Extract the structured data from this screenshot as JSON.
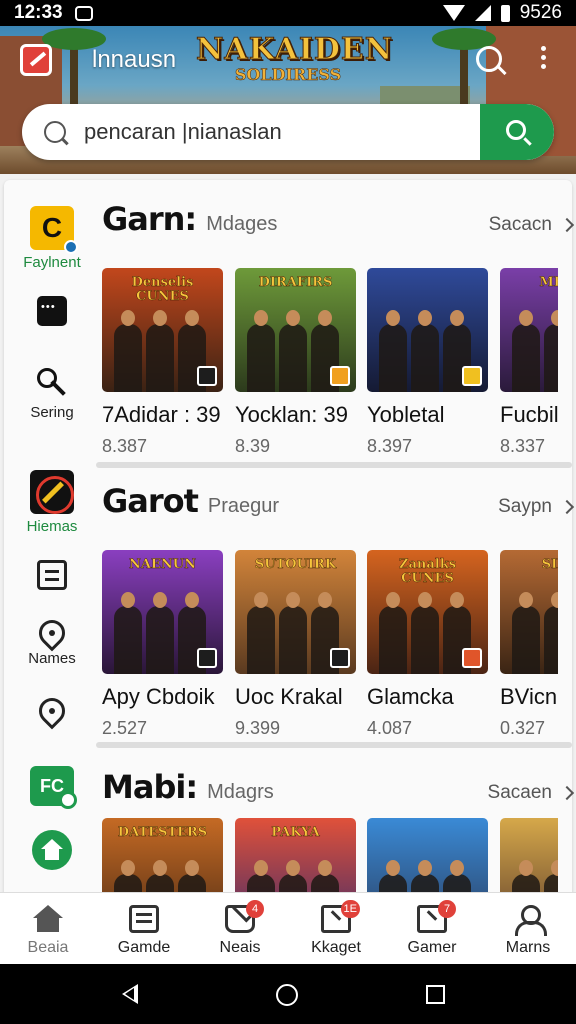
{
  "status_bar": {
    "time": "12:33",
    "right_text": "9526"
  },
  "header": {
    "app_name": "lnnausn",
    "game_logo_line1": "NAKAIDEN",
    "game_logo_line2": "SOLDIRESS",
    "icons": [
      "app-logo-icon",
      "search-icon",
      "more-vert-icon"
    ]
  },
  "search": {
    "value": "pencaran |nianaslan",
    "button_icon": "search-icon"
  },
  "rail": [
    {
      "icon": "c-app-icon",
      "label": "Faylnent"
    },
    {
      "icon": "chat-icon",
      "label": ""
    },
    {
      "icon": "key-icon",
      "label": "Sering"
    },
    {
      "icon": "red-game-icon",
      "label": "Hiemas"
    },
    {
      "icon": "document-icon",
      "label": ""
    },
    {
      "icon": "location-icon",
      "label": "Names"
    },
    {
      "icon": "location-icon",
      "label": ""
    },
    {
      "icon": "fc-icon",
      "label": ""
    },
    {
      "icon": "home-icon",
      "label": ""
    }
  ],
  "sections": [
    {
      "title": "Garn:",
      "subtitle": "Mdages",
      "more": "Sacacn",
      "cards": [
        {
          "name": "7Adidar : 39",
          "rating": "8.387",
          "art": "Denselis CUNES",
          "colors": [
            "#c2471c",
            "#3a2214"
          ],
          "badge": "#1d1d1d"
        },
        {
          "name": "Yocklan: 39",
          "rating": "8.39",
          "art": "DIRAFIRS",
          "colors": [
            "#6e9a3a",
            "#2c3a1c"
          ],
          "badge": "#f0a020"
        },
        {
          "name": "Yobletal",
          "rating": "8.397",
          "art": "",
          "colors": [
            "#2f4a9a",
            "#151a33"
          ],
          "badge": "#f0c020"
        },
        {
          "name": "Fucbill",
          "rating": "8.337",
          "art": "MEIN",
          "colors": [
            "#7a3fa8",
            "#2a1a3a"
          ],
          "badge": "#1d1d1d"
        }
      ]
    },
    {
      "title": "Garot",
      "subtitle": "Praegur",
      "more": "Saypn",
      "cards": [
        {
          "name": "Apy Cbdoik",
          "rating": "2.527",
          "art": "NAENUN",
          "colors": [
            "#8a3fc0",
            "#2a1638"
          ],
          "badge": "#1d1d1d"
        },
        {
          "name": "Uoc Krakal",
          "rating": "9.399",
          "art": "SUTOUIRK",
          "colors": [
            "#d2843a",
            "#5a3a20"
          ],
          "badge": "#1d1d1d"
        },
        {
          "name": "Glamcka",
          "rating": "4.087",
          "art": "Zanalks CUNES",
          "colors": [
            "#d5641f",
            "#4a2414"
          ],
          "badge": "#e0552a"
        },
        {
          "name": "BVicni",
          "rating": "0.327",
          "art": "SIRO",
          "colors": [
            "#b56a34",
            "#3a2414"
          ],
          "badge": "#1d1d1d"
        }
      ]
    },
    {
      "title": "Mabi:",
      "subtitle": "Mdagrs",
      "more": "Sacaen",
      "cards": [
        {
          "name": "",
          "rating": "",
          "art": "DATESTERS",
          "colors": [
            "#c56a24",
            "#4a2a14"
          ],
          "badge": ""
        },
        {
          "name": "",
          "rating": "",
          "art": "PAKYA",
          "colors": [
            "#e0513a",
            "#3a2a6a"
          ],
          "badge": ""
        },
        {
          "name": "",
          "rating": "",
          "art": "",
          "colors": [
            "#3a8ad6",
            "#2a3a5a"
          ],
          "badge": ""
        },
        {
          "name": "",
          "rating": "",
          "art": "",
          "colors": [
            "#d6a84a",
            "#5a3a2a"
          ],
          "badge": ""
        }
      ]
    }
  ],
  "bottom_nav": [
    {
      "icon": "home-icon",
      "label": "Beaia",
      "badge": "",
      "active": true
    },
    {
      "icon": "grid-icon",
      "label": "Gamde",
      "badge": ""
    },
    {
      "icon": "mail-icon",
      "label": "Neais",
      "badge": "4"
    },
    {
      "icon": "tag-icon",
      "label": "Kkaget",
      "badge": "1E"
    },
    {
      "icon": "tag-icon",
      "label": "Gamer",
      "badge": "7"
    },
    {
      "icon": "user-icon",
      "label": "Marns",
      "badge": ""
    }
  ],
  "colors": {
    "accent_green": "#1e9a4d",
    "badge_red": "#e0413a",
    "header_sky": "#3b86b6"
  }
}
